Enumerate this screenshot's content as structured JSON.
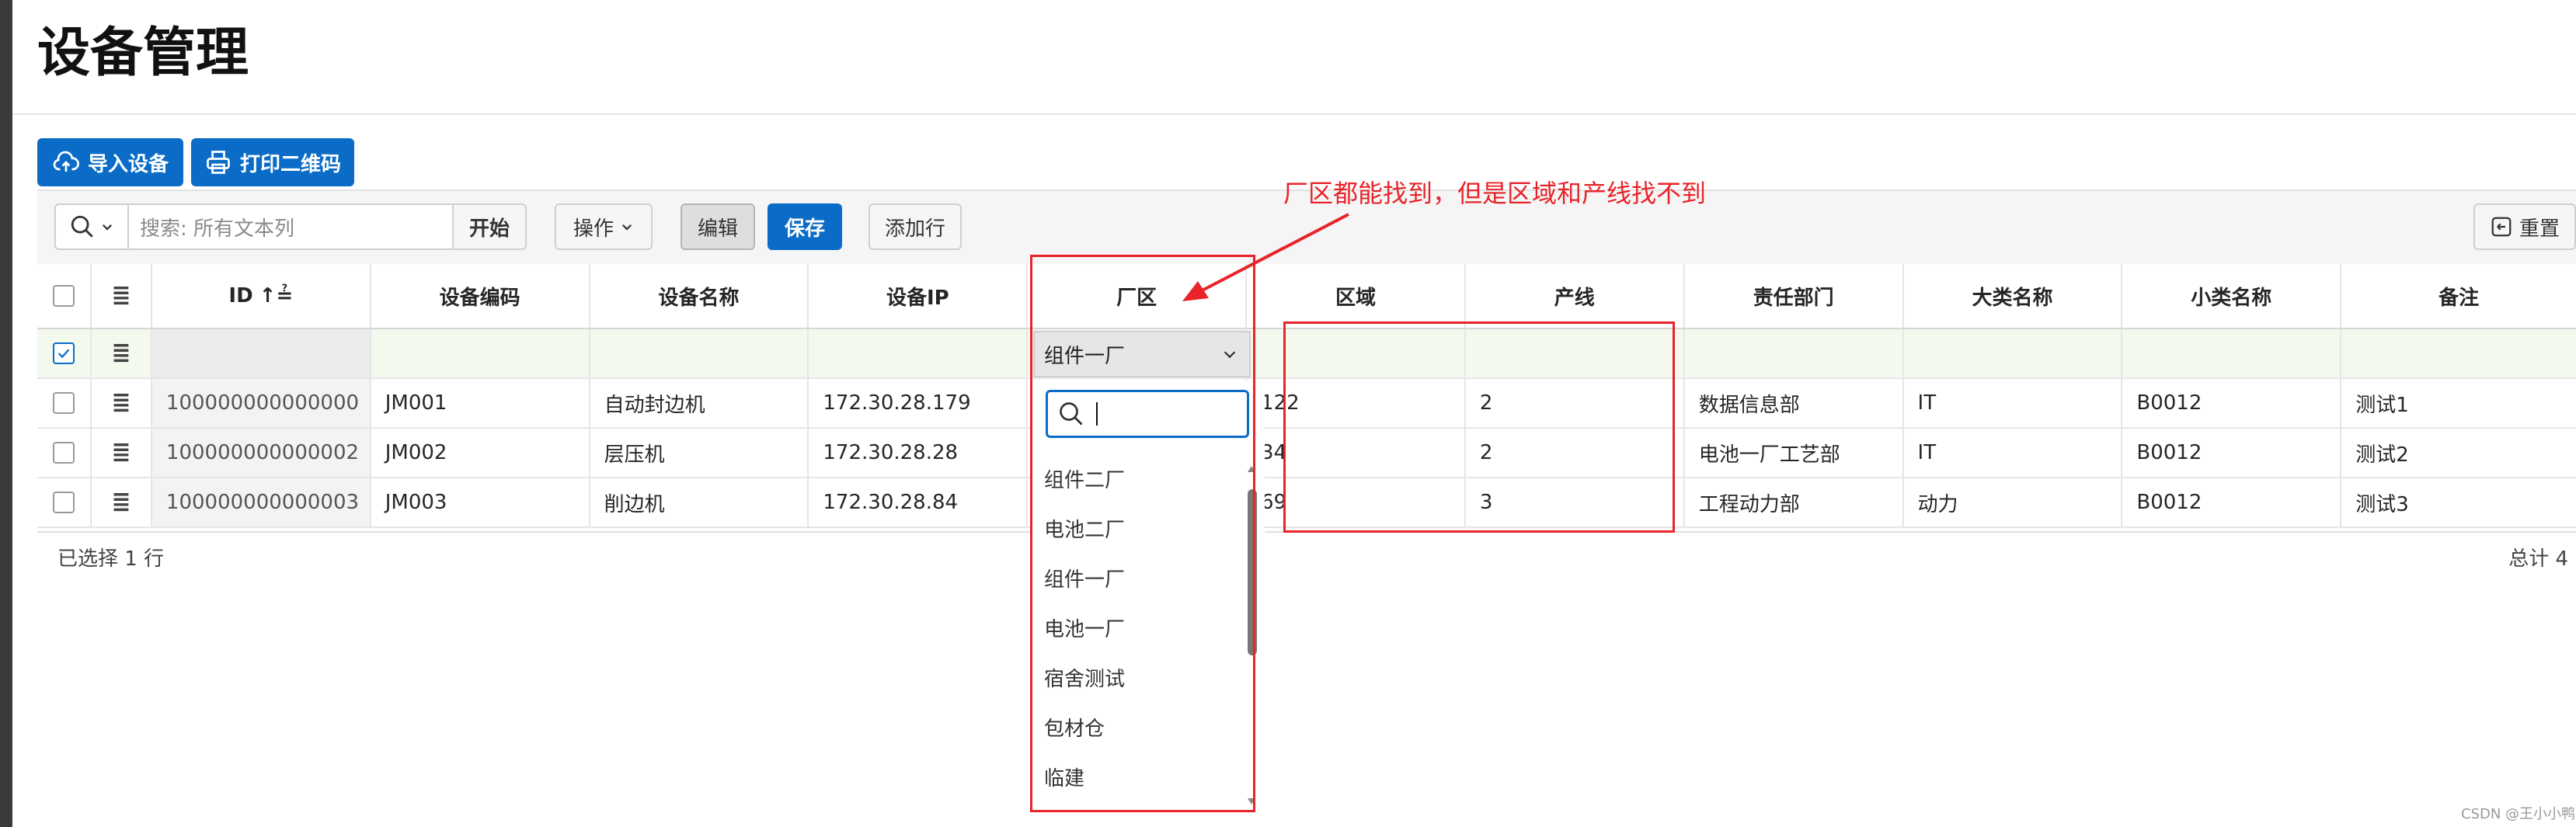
{
  "page": {
    "title": "设备管理"
  },
  "actions": {
    "import_label": "导入设备",
    "print_label": "打印二维码"
  },
  "toolbar": {
    "search_placeholder": "搜索: 所有文本列",
    "go_label": "开始",
    "actions_label": "操作",
    "edit_label": "编辑",
    "save_label": "保存",
    "add_row_label": "添加行",
    "reset_label": "重置"
  },
  "grid": {
    "columns": [
      "ID",
      "设备编码",
      "设备名称",
      "设备IP",
      "厂区",
      "区域",
      "产线",
      "责任部门",
      "大类名称",
      "小类名称",
      "备注"
    ],
    "edit_row": {
      "factory_value": "组件一厂"
    },
    "rows": [
      {
        "id": "100000000000000",
        "code": "JM001",
        "name": "自动封边机",
        "ip": "172.30.28.179",
        "area": "122",
        "line": "2",
        "dept": "数据信息部",
        "major": "IT",
        "minor": "B0012",
        "remark": "测试1"
      },
      {
        "id": "100000000000002",
        "code": "JM002",
        "name": "层压机",
        "ip": "172.30.28.28",
        "area": "34",
        "line": "2",
        "dept": "电池一厂工艺部",
        "major": "IT",
        "minor": "B0012",
        "remark": "测试2"
      },
      {
        "id": "100000000000003",
        "code": "JM003",
        "name": "削边机",
        "ip": "172.30.28.84",
        "area": "69",
        "line": "3",
        "dept": "工程动力部",
        "major": "动力",
        "minor": "B0012",
        "remark": "测试3"
      }
    ]
  },
  "footer": {
    "selected_text": "已选择 1 行",
    "total_text": "总计 4"
  },
  "dropdown": {
    "search_value": "",
    "options": [
      "组件二厂",
      "电池二厂",
      "组件一厂",
      "电池一厂",
      "宿舍测试",
      "包材仓",
      "临建"
    ]
  },
  "annotation": {
    "text": "厂区都能找到，但是区域和产线找不到",
    "color": "#e8232a"
  },
  "watermark": "CSDN @王小小鸭",
  "colors": {
    "primary": "#0b6cc7",
    "annotation_red": "#e8232a"
  }
}
